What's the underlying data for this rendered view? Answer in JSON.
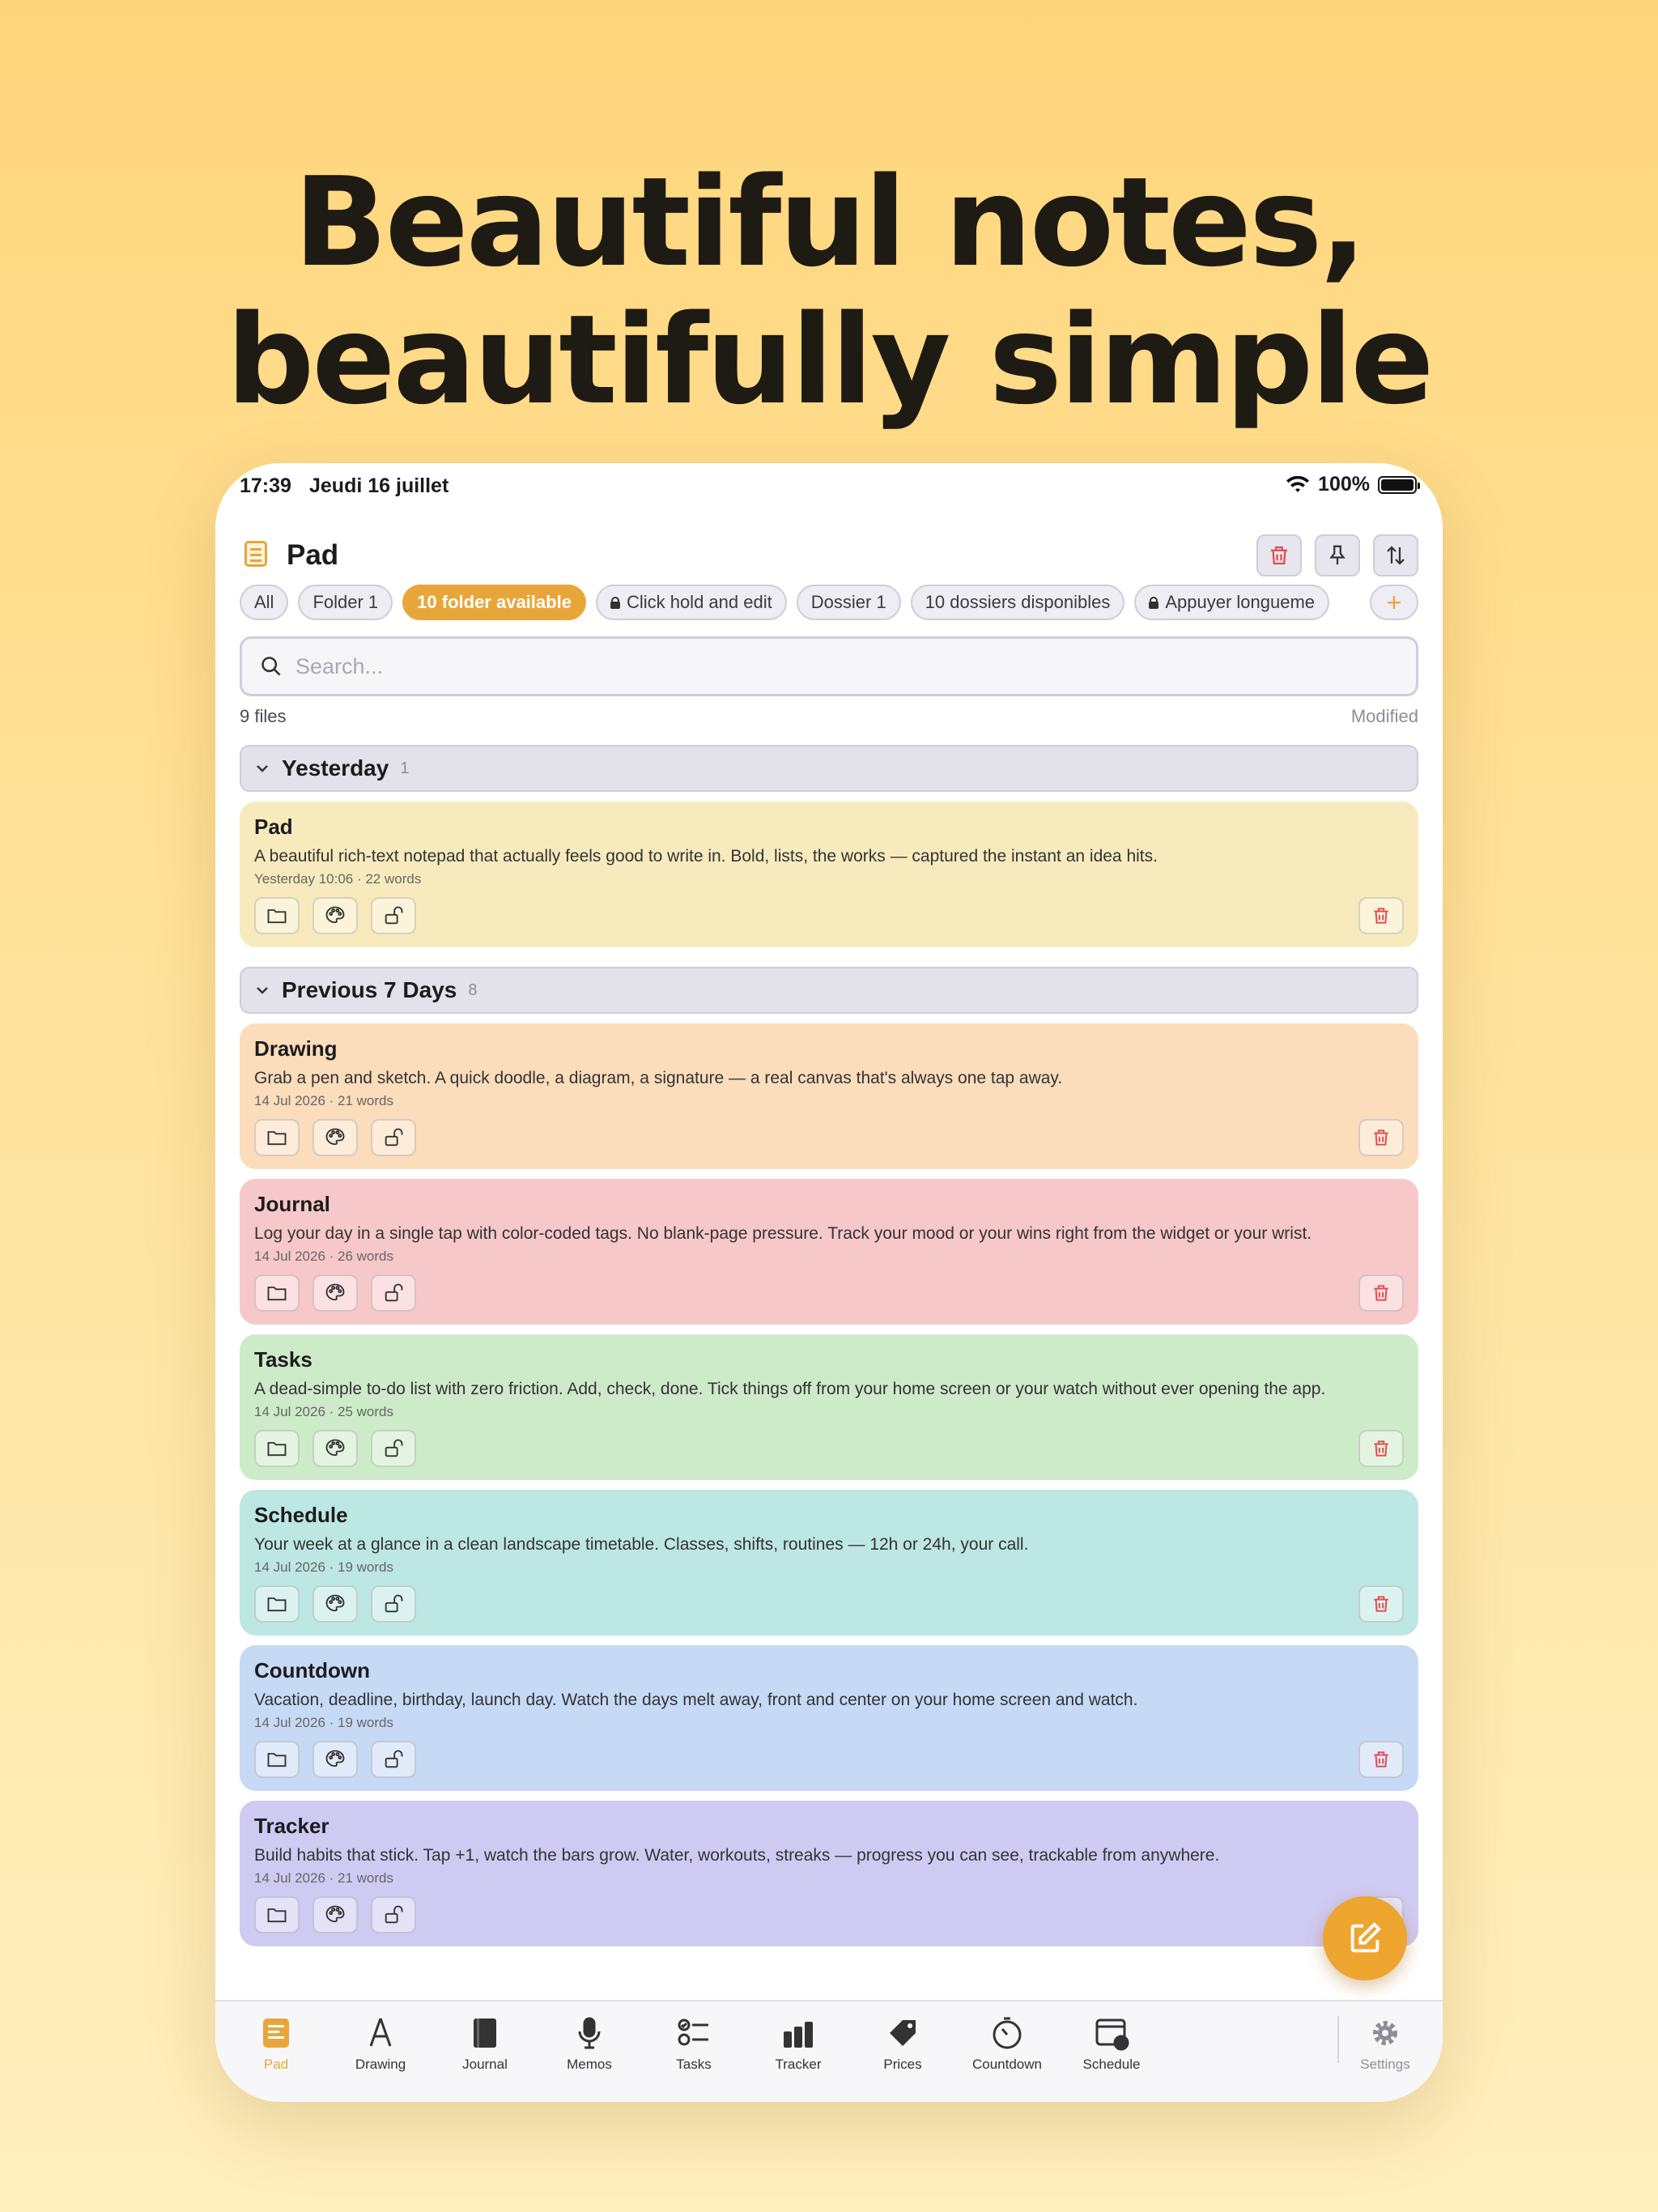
{
  "headline": {
    "line1": "Beautiful notes,",
    "line2": "beautifully simple"
  },
  "status": {
    "time": "17:39",
    "date": "Jeudi 16 juillet",
    "battery": "100%"
  },
  "header": {
    "title": "Pad"
  },
  "chips": [
    "All",
    "Folder 1",
    "10 folder available",
    "Click hold and edit",
    "Dossier 1",
    "10 dossiers disponibles",
    "Appuyer longueme"
  ],
  "search": {
    "placeholder": "Search..."
  },
  "list_meta": {
    "count": "9 files",
    "sort": "Modified"
  },
  "sections": [
    {
      "title": "Yesterday",
      "count": "1"
    },
    {
      "title": "Previous 7 Days",
      "count": "8"
    }
  ],
  "notes": [
    {
      "title": "Pad",
      "body": "A beautiful rich-text notepad that actually feels good to write in. Bold, lists, the works — captured the instant an idea hits.",
      "meta": "Yesterday 10:06  · 22 words",
      "color": "#f7ebbd"
    },
    {
      "title": "Drawing",
      "body": "Grab a pen and sketch. A quick doodle, a diagram, a signature — a real canvas that's always one tap away.",
      "meta": "14 Jul 2026  · 21 words",
      "color": "#fbdcbb"
    },
    {
      "title": "Journal",
      "body": "Log your day in a single tap with color-coded tags. No blank-page pressure. Track your mood or your wins right from the widget or your wrist.",
      "meta": "14 Jul 2026  · 26 words",
      "color": "#f7c8c9"
    },
    {
      "title": "Tasks",
      "body": "A dead-simple to-do list with zero friction. Add, check, done. Tick things off from your home screen or your watch without ever opening the app.",
      "meta": "14 Jul 2026  · 25 words",
      "color": "#cdebc8"
    },
    {
      "title": "Schedule",
      "body": "Your week at a glance in a clean landscape timetable. Classes, shifts, routines — 12h or 24h, your call.",
      "meta": "14 Jul 2026  · 19 words",
      "color": "#bde7e3"
    },
    {
      "title": "Countdown",
      "body": "Vacation, deadline, birthday, launch day. Watch the days melt away, front and center on your home screen and watch.",
      "meta": "14 Jul 2026  · 19 words",
      "color": "#c6d9f5"
    },
    {
      "title": "Tracker",
      "body": "Build habits that stick. Tap +1, watch the bars grow. Water, workouts, streaks — progress you can see, trackable from anywhere.",
      "meta": "14 Jul 2026  · 21 words",
      "color": "#cfcaf2"
    }
  ],
  "tabs": [
    {
      "label": "Pad",
      "icon": "pad-icon"
    },
    {
      "label": "Drawing",
      "icon": "pen-nib-icon"
    },
    {
      "label": "Journal",
      "icon": "book-icon"
    },
    {
      "label": "Memos",
      "icon": "microphone-icon"
    },
    {
      "label": "Tasks",
      "icon": "checklist-icon"
    },
    {
      "label": "Tracker",
      "icon": "bars-icon"
    },
    {
      "label": "Prices",
      "icon": "tag-icon"
    },
    {
      "label": "Countdown",
      "icon": "timer-icon"
    },
    {
      "label": "Schedule",
      "icon": "calendar-clock-icon"
    },
    {
      "label": "Settings",
      "icon": "gear-icon"
    }
  ],
  "colors": {
    "accent": "#e8a63a",
    "delete": "#e5484d"
  }
}
